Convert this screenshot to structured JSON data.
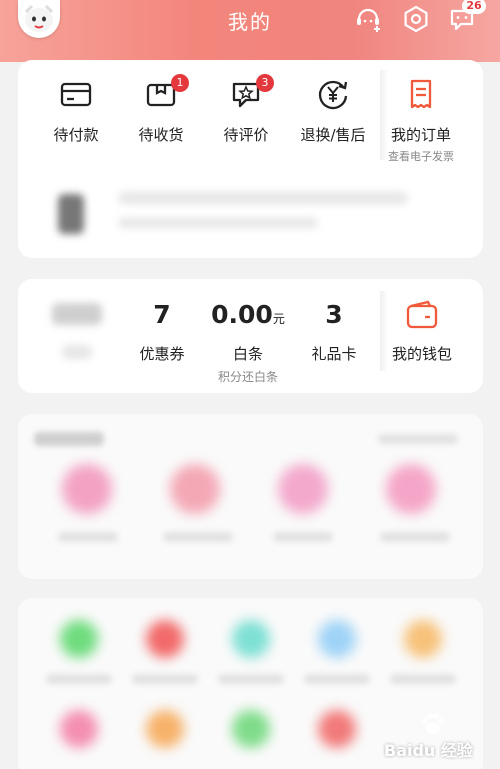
{
  "header": {
    "title": "我的",
    "message_badge": "26"
  },
  "orders": {
    "items": [
      {
        "label": "待付款",
        "icon": "wallet-card-icon"
      },
      {
        "label": "待收货",
        "icon": "package-box-icon",
        "badge": "1"
      },
      {
        "label": "待评价",
        "icon": "review-star-icon",
        "badge": "3"
      },
      {
        "label": "退换/售后",
        "icon": "refund-yen-icon"
      },
      {
        "label": "我的订单",
        "sub": "查看电子发票",
        "icon": "order-list-icon"
      }
    ]
  },
  "wallet": {
    "coupons": {
      "value": "7",
      "label": "优惠券"
    },
    "baitiao": {
      "value": "0.00",
      "unit": "元",
      "label": "白条",
      "sub": "积分还白条"
    },
    "giftcard": {
      "value": "3",
      "label": "礼品卡"
    },
    "my_wallet": {
      "label": "我的钱包",
      "icon": "wallet-icon"
    }
  },
  "colors": {
    "brand_red": "#e4393c",
    "header_pink": "#f3857b",
    "icon_orange": "#f05a3a"
  },
  "watermark": {
    "text": "Baidu 经验"
  }
}
